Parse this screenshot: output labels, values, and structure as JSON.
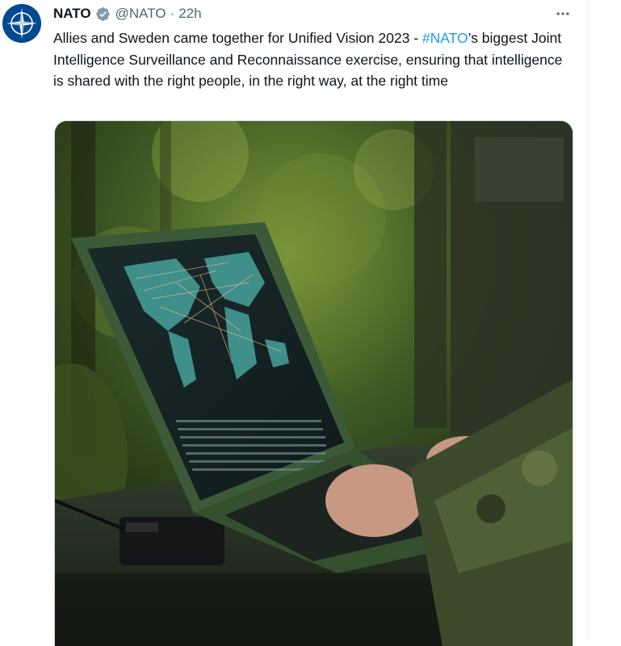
{
  "tweet": {
    "author_name": "NATO",
    "handle": "@NATO",
    "separator": "·",
    "time": "22h",
    "text_before": "Allies and Sweden came together for Unified Vision 2023 - ",
    "hashtag": "#NATO",
    "text_after": "’s biggest Joint Intelligence Surveillance and Reconnaissance exercise, ensuring that intelligence is shared with the right people, in the right way, at the right time"
  },
  "icons": {
    "avatar": "nato-compass-logo-icon",
    "verified": "verified-badge-icon",
    "more": "more-options-icon"
  },
  "colors": {
    "hashtag": "#1d9bf0",
    "secondary_text": "#536471",
    "avatar_bg": "#004990"
  },
  "media": {
    "description_icon": "photo-soldier-laptop-world-map"
  }
}
